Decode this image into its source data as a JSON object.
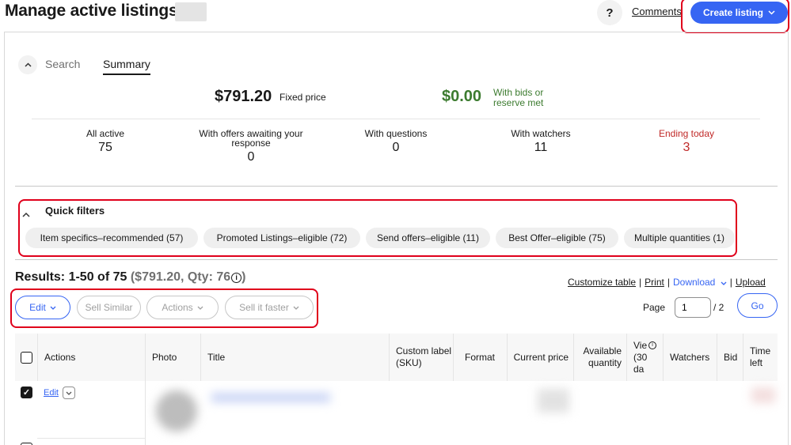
{
  "header": {
    "title": "Manage active listings",
    "help_label": "?",
    "comments_label": "Comments",
    "create_listing_label": "Create listing"
  },
  "summary": {
    "tabs": [
      {
        "label": "Search",
        "selected": false
      },
      {
        "label": "Summary",
        "selected": true
      }
    ],
    "fixed_price_amount": "$791.20",
    "fixed_price_label": "Fixed price",
    "bids_amount": "$0.00",
    "bids_label_line1": "With bids or",
    "bids_label_line2": "reserve met",
    "stats": [
      {
        "label": "All active",
        "value": "75"
      },
      {
        "label": "With offers awaiting your response",
        "value": "0"
      },
      {
        "label": "With questions",
        "value": "0"
      },
      {
        "label": "With watchers",
        "value": "11"
      },
      {
        "label": "Ending today",
        "value": "3"
      }
    ]
  },
  "quick_filters": {
    "title": "Quick filters",
    "chips": [
      "Item specifics–recommended (57)",
      "Promoted Listings–eligible (72)",
      "Send offers–eligible (11)",
      "Best Offer–eligible (75)",
      "Multiple quantities (1)"
    ]
  },
  "results": {
    "title_main": "Results: 1-50 of 75",
    "title_detail": "($791.20, Qty: 76",
    "info_icon": "i",
    "links": {
      "customize": "Customize table",
      "print": "Print",
      "download": "Download",
      "upload": "Upload"
    },
    "bulk_actions": {
      "edit": "Edit",
      "sell_similar": "Sell Similar",
      "actions": "Actions",
      "sell_faster": "Sell it faster"
    },
    "pagination": {
      "page_label": "Page",
      "page_value": "1",
      "total": "/ 2",
      "go_label": "Go"
    }
  },
  "table": {
    "columns": [
      "Actions",
      "Photo",
      "Title",
      "Custom label (SKU)",
      "Format",
      "Current price",
      "Available quantity",
      "Vie (30 da",
      "Watchers",
      "Bid",
      "Time left"
    ],
    "row": {
      "edit_label": "Edit",
      "checked": true
    }
  },
  "colors": {
    "accent": "#3665f3",
    "annotation": "#e0001b",
    "green": "#3c7b2f",
    "red": "#c02928"
  }
}
